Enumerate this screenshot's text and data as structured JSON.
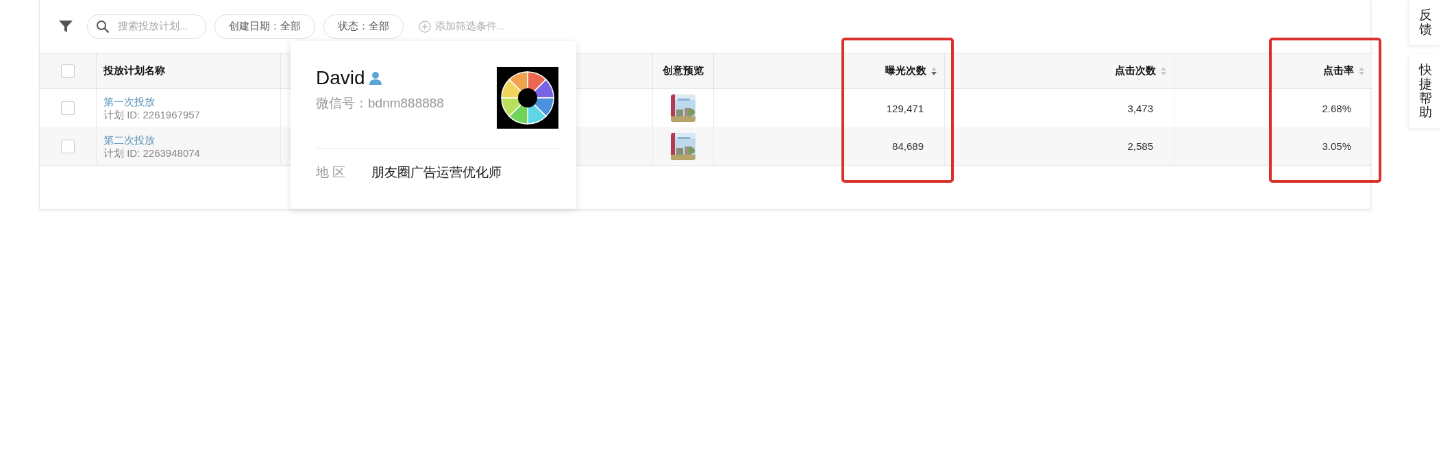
{
  "filter_bar": {
    "search": {
      "placeholder": "搜索投放计划..."
    },
    "filters": [
      {
        "label": "创建日期：全部"
      },
      {
        "label": "状态：全部"
      }
    ],
    "add_filter": "添加筛选条件..."
  },
  "table": {
    "select_all": {
      "checked": false
    },
    "columns": [
      {
        "label": "投放计划名称",
        "highlighted": false
      },
      {
        "label": "创意预览",
        "highlighted": false
      },
      {
        "label": "曝光次数",
        "sortable": true,
        "sorted_descending": true,
        "highlighted": true
      },
      {
        "label": "点击次数",
        "sortable": true,
        "sorted_descending": false,
        "highlighted": false
      },
      {
        "label": "点击率",
        "sortable": true,
        "sorted_descending": false,
        "highlighted": true
      }
    ],
    "rows": [
      {
        "checked": false,
        "cells": [
          {
            "kind": "plan",
            "name": "第一次投放",
            "id": "计划 ID: 2261967957"
          },
          {
            "kind": "picture"
          },
          {
            "kind": "number",
            "text": "129,471"
          },
          {
            "kind": "number",
            "text": "3,473"
          },
          {
            "kind": "number",
            "text": "2.68%"
          }
        ]
      },
      {
        "checked": false,
        "cells": [
          {
            "kind": "plan",
            "name": "第二次投放",
            "id": "计划 ID: 2263948074"
          },
          {
            "kind": "picture"
          },
          {
            "kind": "number",
            "text": "84,689"
          },
          {
            "kind": "number",
            "text": "2,585"
          },
          {
            "kind": "number",
            "text": "3.05%"
          }
        ]
      }
    ]
  },
  "profile_popup": {
    "name": "David",
    "wechat_id": "微信号：bdnm888888",
    "region_label": "地 区",
    "region": "朋友圈广告运营优化师"
  },
  "side_tabs": [
    {
      "label": "反馈"
    },
    {
      "label": "快捷帮助"
    }
  ]
}
